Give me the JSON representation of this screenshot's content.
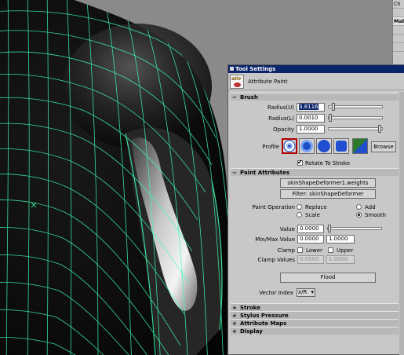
{
  "channel_box": {
    "rows": [
      {
        "label": "Ch",
        "selected": false
      },
      {
        "label": "",
        "selected": false
      },
      {
        "label": "Mal",
        "selected": true
      },
      {
        "label": "",
        "selected": false
      },
      {
        "label": "",
        "selected": false
      },
      {
        "label": "",
        "selected": false
      }
    ]
  },
  "window": {
    "title": "Tool Settings",
    "tool_name": "Attribute Paint",
    "tool_icon": "attribute-paint-icon"
  },
  "sections": {
    "brush": {
      "label": "Brush",
      "toggle": "−",
      "radius_u": {
        "label": "Radius(U)",
        "value": "3.8116",
        "slider_fraction": 0.06
      },
      "radius_l": {
        "label": "Radius(L)",
        "value": "0.0010",
        "slider_fraction": 0.0
      },
      "opacity": {
        "label": "Opacity",
        "value": "1.0000",
        "slider_fraction": 1.0
      },
      "profile": {
        "label": "Profile",
        "browse_label": "Browse",
        "selected_index": 0,
        "shapes": [
          "gaussian",
          "soft",
          "solid-circle",
          "square"
        ]
      },
      "rotate_to_stroke": {
        "label": "Rotate To Stroke",
        "checked": true
      }
    },
    "paint_attributes": {
      "label": "Paint Attributes",
      "toggle": "−",
      "attribute_button": "skinShapeDeformer1.weights",
      "filter_button": "Filter: skinShapeDeformer",
      "paint_operation": {
        "label": "Paint Operation",
        "options": [
          "Replace",
          "Add",
          "Scale",
          "Smooth"
        ],
        "selected": "Smooth"
      },
      "value": {
        "label": "Value",
        "value": "0.0000",
        "slider_fraction": 0.0
      },
      "min_max": {
        "label": "Min/Max Value",
        "min": "0.0000",
        "max": "1.0000"
      },
      "clamp": {
        "label": "Clamp",
        "lower": "Lower",
        "upper": "Upper",
        "lower_checked": false,
        "upper_checked": false
      },
      "clamp_values": {
        "label": "Clamp Values",
        "min": "0.0000",
        "max": "1.0000"
      },
      "flood_button": "Flood",
      "vector_index": {
        "label": "Vector Index",
        "value": "x/R"
      }
    },
    "collapsed": [
      {
        "label": "Stroke",
        "toggle": "+"
      },
      {
        "label": "Stylus Pressure",
        "toggle": "+"
      },
      {
        "label": "Attribute Maps",
        "toggle": "+"
      },
      {
        "label": "Display",
        "toggle": "+"
      }
    ]
  },
  "colors": {
    "viewport_bg": "#8a8a8a",
    "wireframe": "#3dffb0",
    "panel_bg": "#c8c8c8",
    "title_bar": "#0a246a",
    "selected_profile_border": "#b00000"
  }
}
